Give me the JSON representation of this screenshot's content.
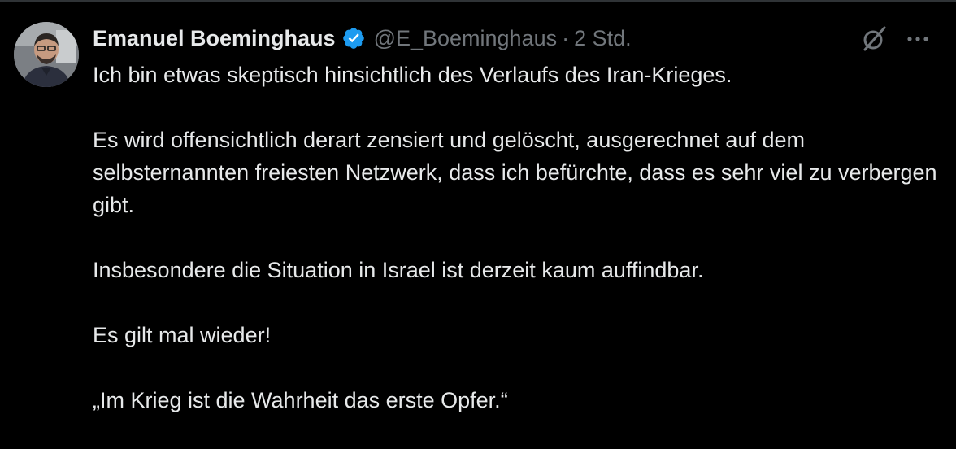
{
  "author": {
    "display_name": "Emanuel Boeminghaus",
    "handle": "@E_Boeminghaus",
    "separator": "·",
    "time": "2 Std.",
    "verified": true,
    "verified_color": "#1d9bf0"
  },
  "tweet": {
    "paragraphs": [
      "Ich bin etwas skeptisch hinsichtlich des Verlaufs des Iran-Krieges.",
      "Es wird offensichtlich derart zensiert und gelöscht, ausgerechnet auf dem selbsternannten freiesten Netzwerk, dass ich befürchte, dass es sehr viel zu verbergen gibt.",
      "Insbesondere die Situation in Israel ist derzeit kaum auffindbar.",
      "Es gilt mal wieder!",
      "„Im Krieg ist die Wahrheit das erste Opfer.“"
    ]
  },
  "icons": {
    "avatar": "avatar-photo",
    "verified": "verified-badge-icon",
    "grok": "grok-icon",
    "more": "more-options-icon"
  },
  "colors": {
    "background": "#000000",
    "text_primary": "#e7e9ea",
    "text_secondary": "#71767b",
    "border": "#2f3336"
  }
}
